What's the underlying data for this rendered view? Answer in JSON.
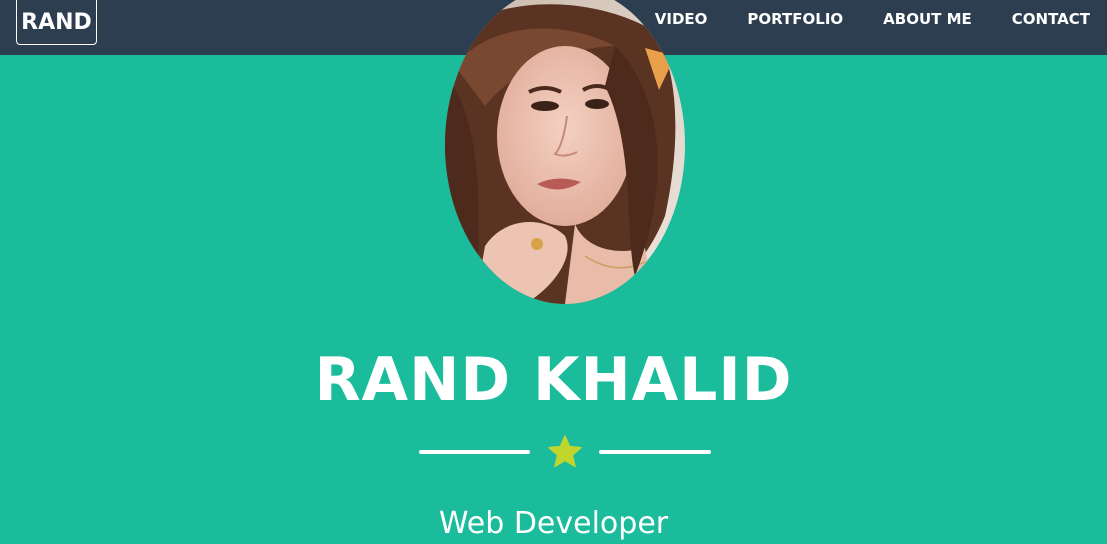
{
  "navbar": {
    "brand": "RAND",
    "links": [
      {
        "label": "VIDEO"
      },
      {
        "label": "PORTFOLIO"
      },
      {
        "label": "ABOUT ME"
      },
      {
        "label": "CONTACT"
      }
    ]
  },
  "header": {
    "name": "RAND KHALID",
    "role": "Web Developer",
    "divider_icon": "star-icon"
  },
  "colors": {
    "navbar_bg": "#2c3e50",
    "page_bg": "#1abc9c",
    "star": "#c0d62f",
    "text": "#ffffff"
  }
}
